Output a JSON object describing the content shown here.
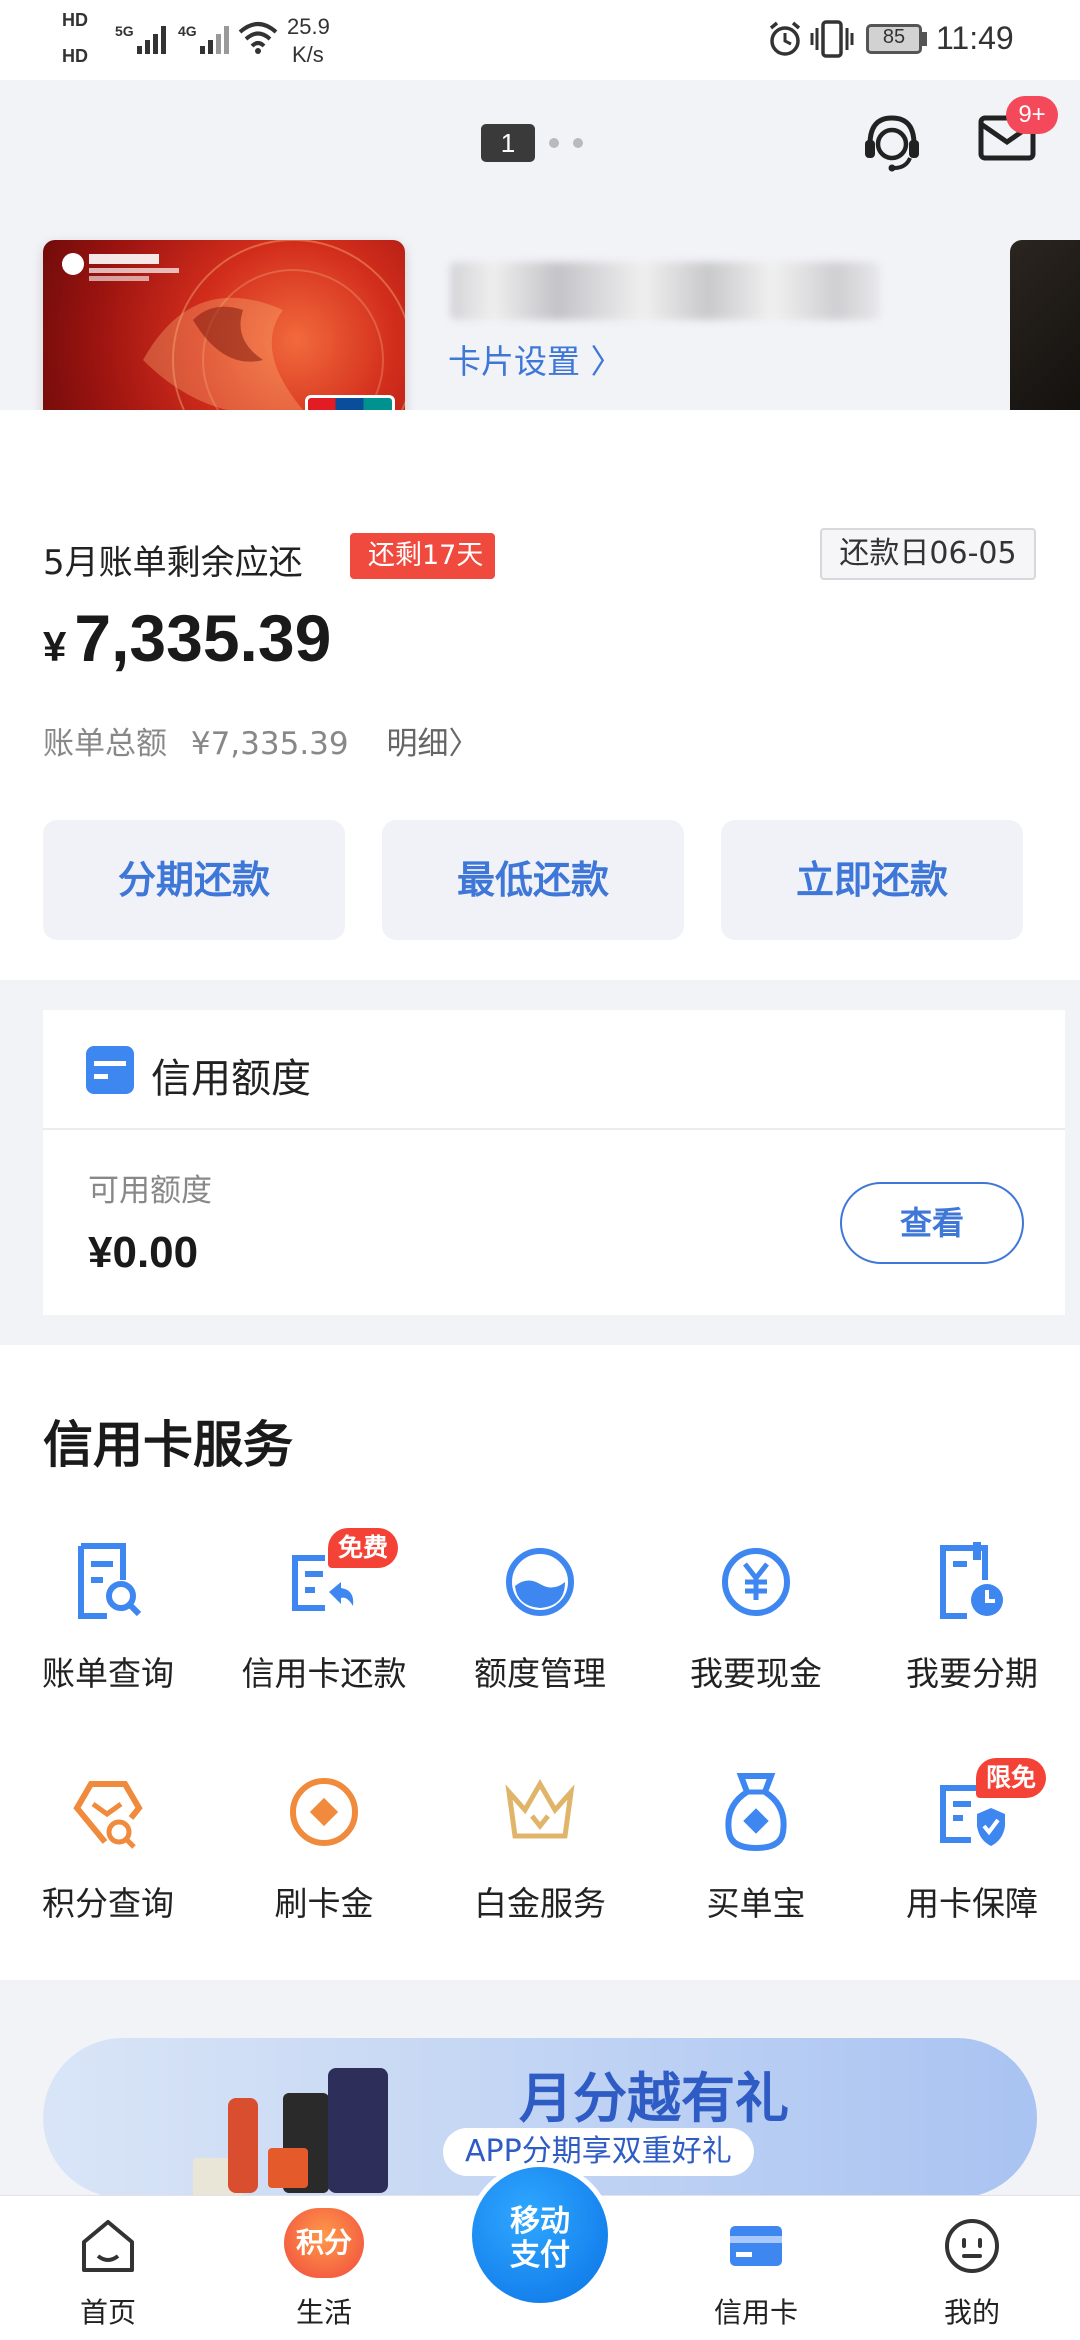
{
  "status_bar": {
    "hd1": "HD",
    "hd2": "HD",
    "net_speed_value": "25.9",
    "net_speed_unit": "K/s",
    "battery": "85",
    "time": "11:49"
  },
  "header": {
    "page_indicator": "1",
    "message_badge": "9+"
  },
  "card": {
    "settings_label": "卡片设置 〉"
  },
  "bill": {
    "title": "5月账单剩余应还",
    "remaining_days": "还剩17天",
    "due_date": "还款日06-05",
    "currency": "¥",
    "amount": "7,335.39",
    "total_label": "账单总额",
    "total_value": "¥7,335.39",
    "detail_link": "明细〉"
  },
  "actions": [
    {
      "label": "分期还款"
    },
    {
      "label": "最低还款"
    },
    {
      "label": "立即还款"
    }
  ],
  "credit": {
    "title": "信用额度",
    "available_label": "可用额度",
    "available_amount": "¥0.00",
    "view_button": "查看"
  },
  "services": {
    "title": "信用卡服务",
    "items": [
      {
        "label": "账单查询",
        "icon": "bill-search-icon"
      },
      {
        "label": "信用卡还款",
        "icon": "card-repay-icon",
        "badge": "免费"
      },
      {
        "label": "额度管理",
        "icon": "limit-manage-icon"
      },
      {
        "label": "我要现金",
        "icon": "cash-icon"
      },
      {
        "label": "我要分期",
        "icon": "installment-icon"
      },
      {
        "label": "积分查询",
        "icon": "points-search-icon"
      },
      {
        "label": "刷卡金",
        "icon": "swipe-reward-icon"
      },
      {
        "label": "白金服务",
        "icon": "crown-icon"
      },
      {
        "label": "买单宝",
        "icon": "pay-bag-icon"
      },
      {
        "label": "用卡保障",
        "icon": "card-protect-icon",
        "badge": "限免"
      }
    ]
  },
  "banner": {
    "title": "月分越有礼",
    "subtitle": "APP分期享双重好礼"
  },
  "tabbar": {
    "home": "首页",
    "life": "生活",
    "life_badge": "积分",
    "mobile_pay": "移动支付",
    "mobile_pay_line1": "移动",
    "mobile_pay_line2": "支付",
    "credit_card": "信用卡",
    "mine": "我的"
  },
  "colors": {
    "accent": "#3e77d8",
    "red": "#f04a3e",
    "background": "#f2f3f7"
  }
}
